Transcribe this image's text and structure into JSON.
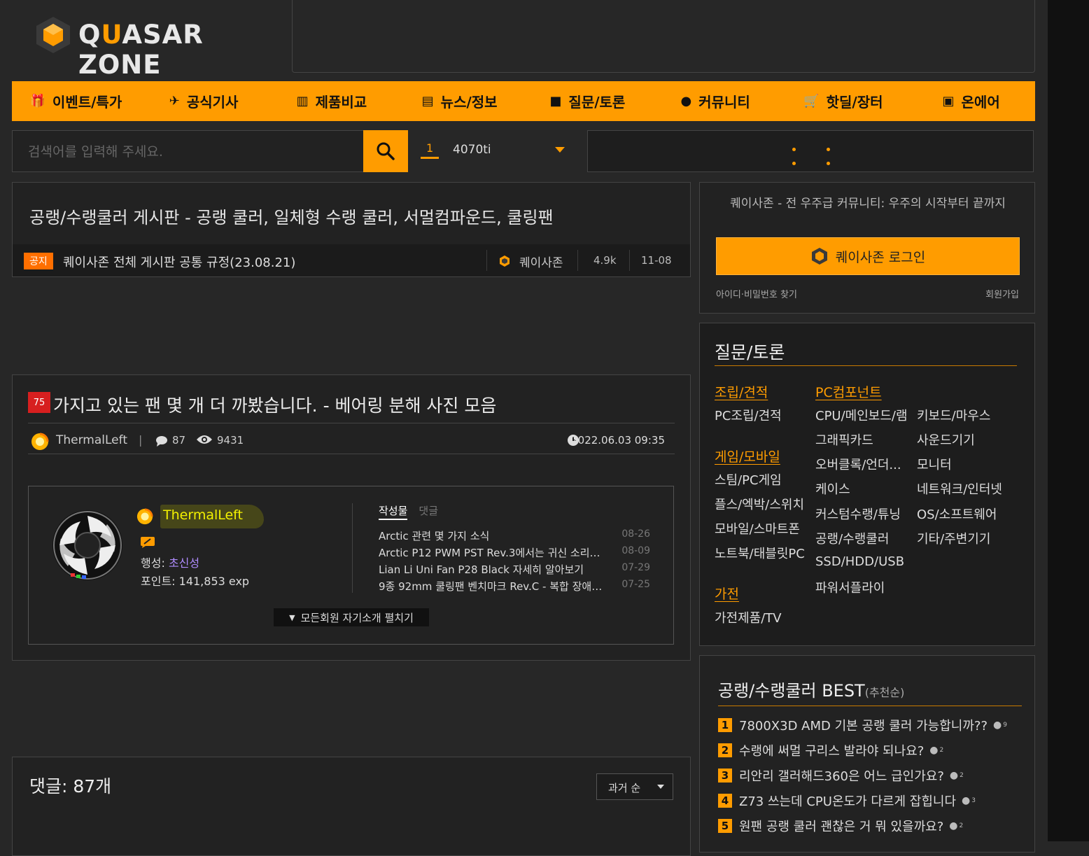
{
  "brand": {
    "logo_text_a": "Q",
    "logo_text_u": "U",
    "logo_text_b": "ASAR ZONE"
  },
  "nav": [
    {
      "label": "이벤트/특가",
      "icon": "gift-icon"
    },
    {
      "label": "공식기사",
      "icon": "satellite-icon"
    },
    {
      "label": "제품비교",
      "icon": "bar-chart-icon"
    },
    {
      "label": "뉴스/정보",
      "icon": "newspaper-icon"
    },
    {
      "label": "질문/토론",
      "icon": "question-bubble-icon"
    },
    {
      "label": "커뮤니티",
      "icon": "chat-bubbles-icon"
    },
    {
      "label": "핫딜/장터",
      "icon": "cart-icon"
    },
    {
      "label": "온에어",
      "icon": "tv-icon"
    }
  ],
  "search": {
    "placeholder": "검색어를 입력해 주세요.",
    "value": ""
  },
  "ranking": {
    "rank": "1",
    "keyword": "4070ti"
  },
  "board": {
    "title": "공랭/수랭쿨러 게시판 - 공랭 쿨러, 일체형 수랭 쿨러, 서멀컴파운드, 쿨링팬",
    "notice": {
      "badge": "공지",
      "title": "퀘이사존 전체 게시판 공통 규정(23.08.21)",
      "author": "퀘이사존",
      "views": "4.9k",
      "date": "11-08"
    }
  },
  "post": {
    "badge": "75",
    "title": "가지고 있는 팬 몇 개 더 까봤습니다. - 베어링 분해 사진 모음",
    "author": "ThermalLeft",
    "separator": "|",
    "comments": "87",
    "views": "9431",
    "datetime": "2022.06.03 09:35",
    "profile": {
      "name": "ThermalLeft",
      "rank_label": "행성:",
      "rank_value": "초신성",
      "points": "포인트: 141,853 exp",
      "tab_posts": "작성물",
      "tab_comments": "댓글",
      "recent": [
        {
          "title": "Arctic 관련 몇 가지 소식",
          "date": "08-26"
        },
        {
          "title": "Arctic P12 PWM PST Rev.3에서는 귀신 소리가 ...",
          "date": "08-09"
        },
        {
          "title": "Lian Li Uni Fan P28 Black 자세히 알아보기",
          "date": "07-29"
        },
        {
          "title": "9종 92mm 쿨링팬 벤치마크 Rev.C - 복합 장애물...",
          "date": "07-25"
        }
      ],
      "expand_label": "모든회원 자기소개 펼치기"
    }
  },
  "comments": {
    "title": "댓글: 87개",
    "sort": "과거 순"
  },
  "login": {
    "tagline": "퀘이사존 - 전 우주급 커뮤니티: 우주의 시작부터 끝까지",
    "button": "퀘이사존 로그인",
    "find": "아이디·비밀번호 찾기",
    "join": "회원가입"
  },
  "categories": {
    "title": "질문/토론",
    "groups": {
      "build": {
        "heading": "조립/견적",
        "items": [
          "PC조립/견적"
        ]
      },
      "game": {
        "heading": "게임/모바일",
        "items": [
          "스팀/PC게임",
          "플스/엑박/스위치",
          "모바일/스마트폰",
          "노트북/태블릿PC"
        ]
      },
      "appliance": {
        "heading": "가전",
        "items": [
          "가전제품/TV"
        ]
      },
      "pc": {
        "heading": "PC컴포넌트",
        "items": [
          "CPU/메인보드/램",
          "그래픽카드",
          "오버클록/언더...",
          "케이스",
          "커스텀수랭/튜닝",
          "공랭/수랭쿨러",
          "SSD/HDD/USB",
          "파워서플라이"
        ]
      },
      "pc2": {
        "items": [
          "키보드/마우스",
          "사운드기기",
          "모니터",
          "네트워크/인터넷",
          "OS/소프트웨어",
          "기타/주변기기"
        ]
      }
    }
  },
  "best": {
    "title": "공랭/수랭쿨러 BEST",
    "subtitle": "(추천순)",
    "items": [
      {
        "num": "1",
        "title": "7800X3D AMD 기본 공랭 쿨러 가능합니까??",
        "comments": "9"
      },
      {
        "num": "2",
        "title": "수랭에 써멀 구리스 발라야 되나요?",
        "comments": "2"
      },
      {
        "num": "3",
        "title": "리안리 갤러해드360은 어느 급인가요?",
        "comments": "2"
      },
      {
        "num": "4",
        "title": "Z73 쓰는데 CPU온도가 다르게 잡힙니다",
        "comments": "3"
      },
      {
        "num": "5",
        "title": "원팬 공랭 쿨러 괜찮은 거 뭐 있을까요?",
        "comments": "2"
      }
    ]
  },
  "colors": {
    "accent": "#ff9c00",
    "background": "#272727",
    "notice_badge": "#ff6f00",
    "post_badge": "#d71f1f",
    "rank_value": "#b08cff"
  }
}
